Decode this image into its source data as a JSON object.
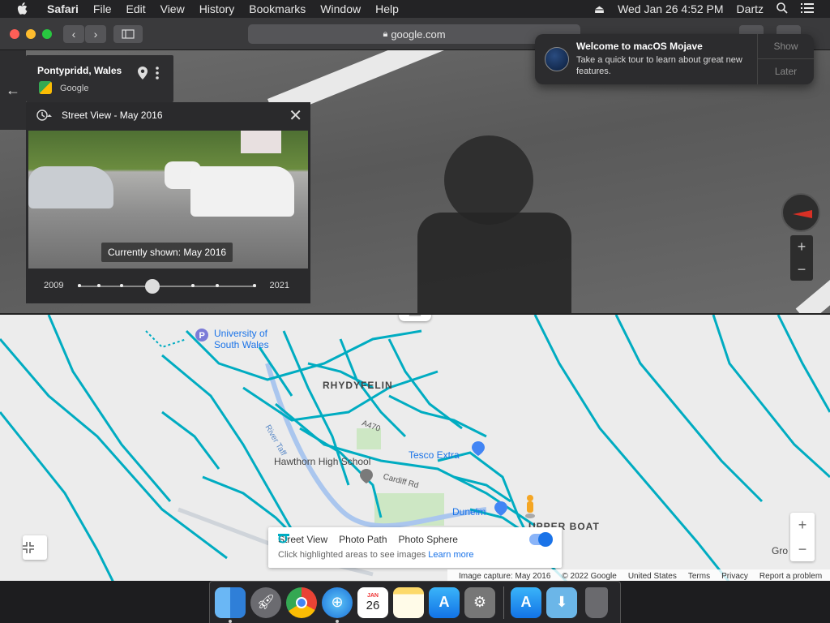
{
  "menubar": {
    "app": "Safari",
    "items": [
      "File",
      "Edit",
      "View",
      "History",
      "Bookmarks",
      "Window",
      "Help"
    ],
    "datetime": "Wed Jan 26  4:52 PM",
    "user": "Dartz"
  },
  "browser": {
    "url": "google.com"
  },
  "notification": {
    "title": "Welcome to macOS Mojave",
    "body": "Take a quick tour to learn about great new features.",
    "show": "Show",
    "later": "Later"
  },
  "place": {
    "title": "Pontypridd, Wales",
    "source": "Google"
  },
  "streetview": {
    "header": "Street View - May 2016",
    "shown": "Currently shown: May 2016",
    "year_start": "2009",
    "year_end": "2021",
    "slider_position": 0.42
  },
  "map": {
    "labels": {
      "univ1": "University of",
      "univ2": "South Wales",
      "rhydyfelin": "RHYDYFELIN",
      "river": "River Taff",
      "a470": "A470",
      "tesco": "Tesco Extra",
      "hawthorn": "Hawthorn High School",
      "cardiff": "Cardiff Rd",
      "dunelm": "Dunelm",
      "upperboat": "UPPER BOAT",
      "gro": "Gro"
    },
    "legend": {
      "street_view": "Street View",
      "photo_path": "Photo Path",
      "photo_sphere": "Photo Sphere",
      "hint": "Click highlighted areas to see images",
      "learn_more": "Learn more"
    },
    "footer": [
      "Image capture: May 2016",
      "© 2022 Google",
      "United States",
      "Terms",
      "Privacy",
      "Report a problem"
    ]
  },
  "colors": {
    "coverage": "#00acc1",
    "accent": "#1a73e8"
  },
  "dock": {
    "apps": [
      "Finder",
      "Launchpad",
      "Chrome",
      "Safari",
      "Calendar",
      "Notes",
      "App Store",
      "System Preferences",
      "App Store",
      "Downloads",
      "Trash"
    ],
    "calendar_month": "JAN",
    "calendar_day": "26"
  }
}
